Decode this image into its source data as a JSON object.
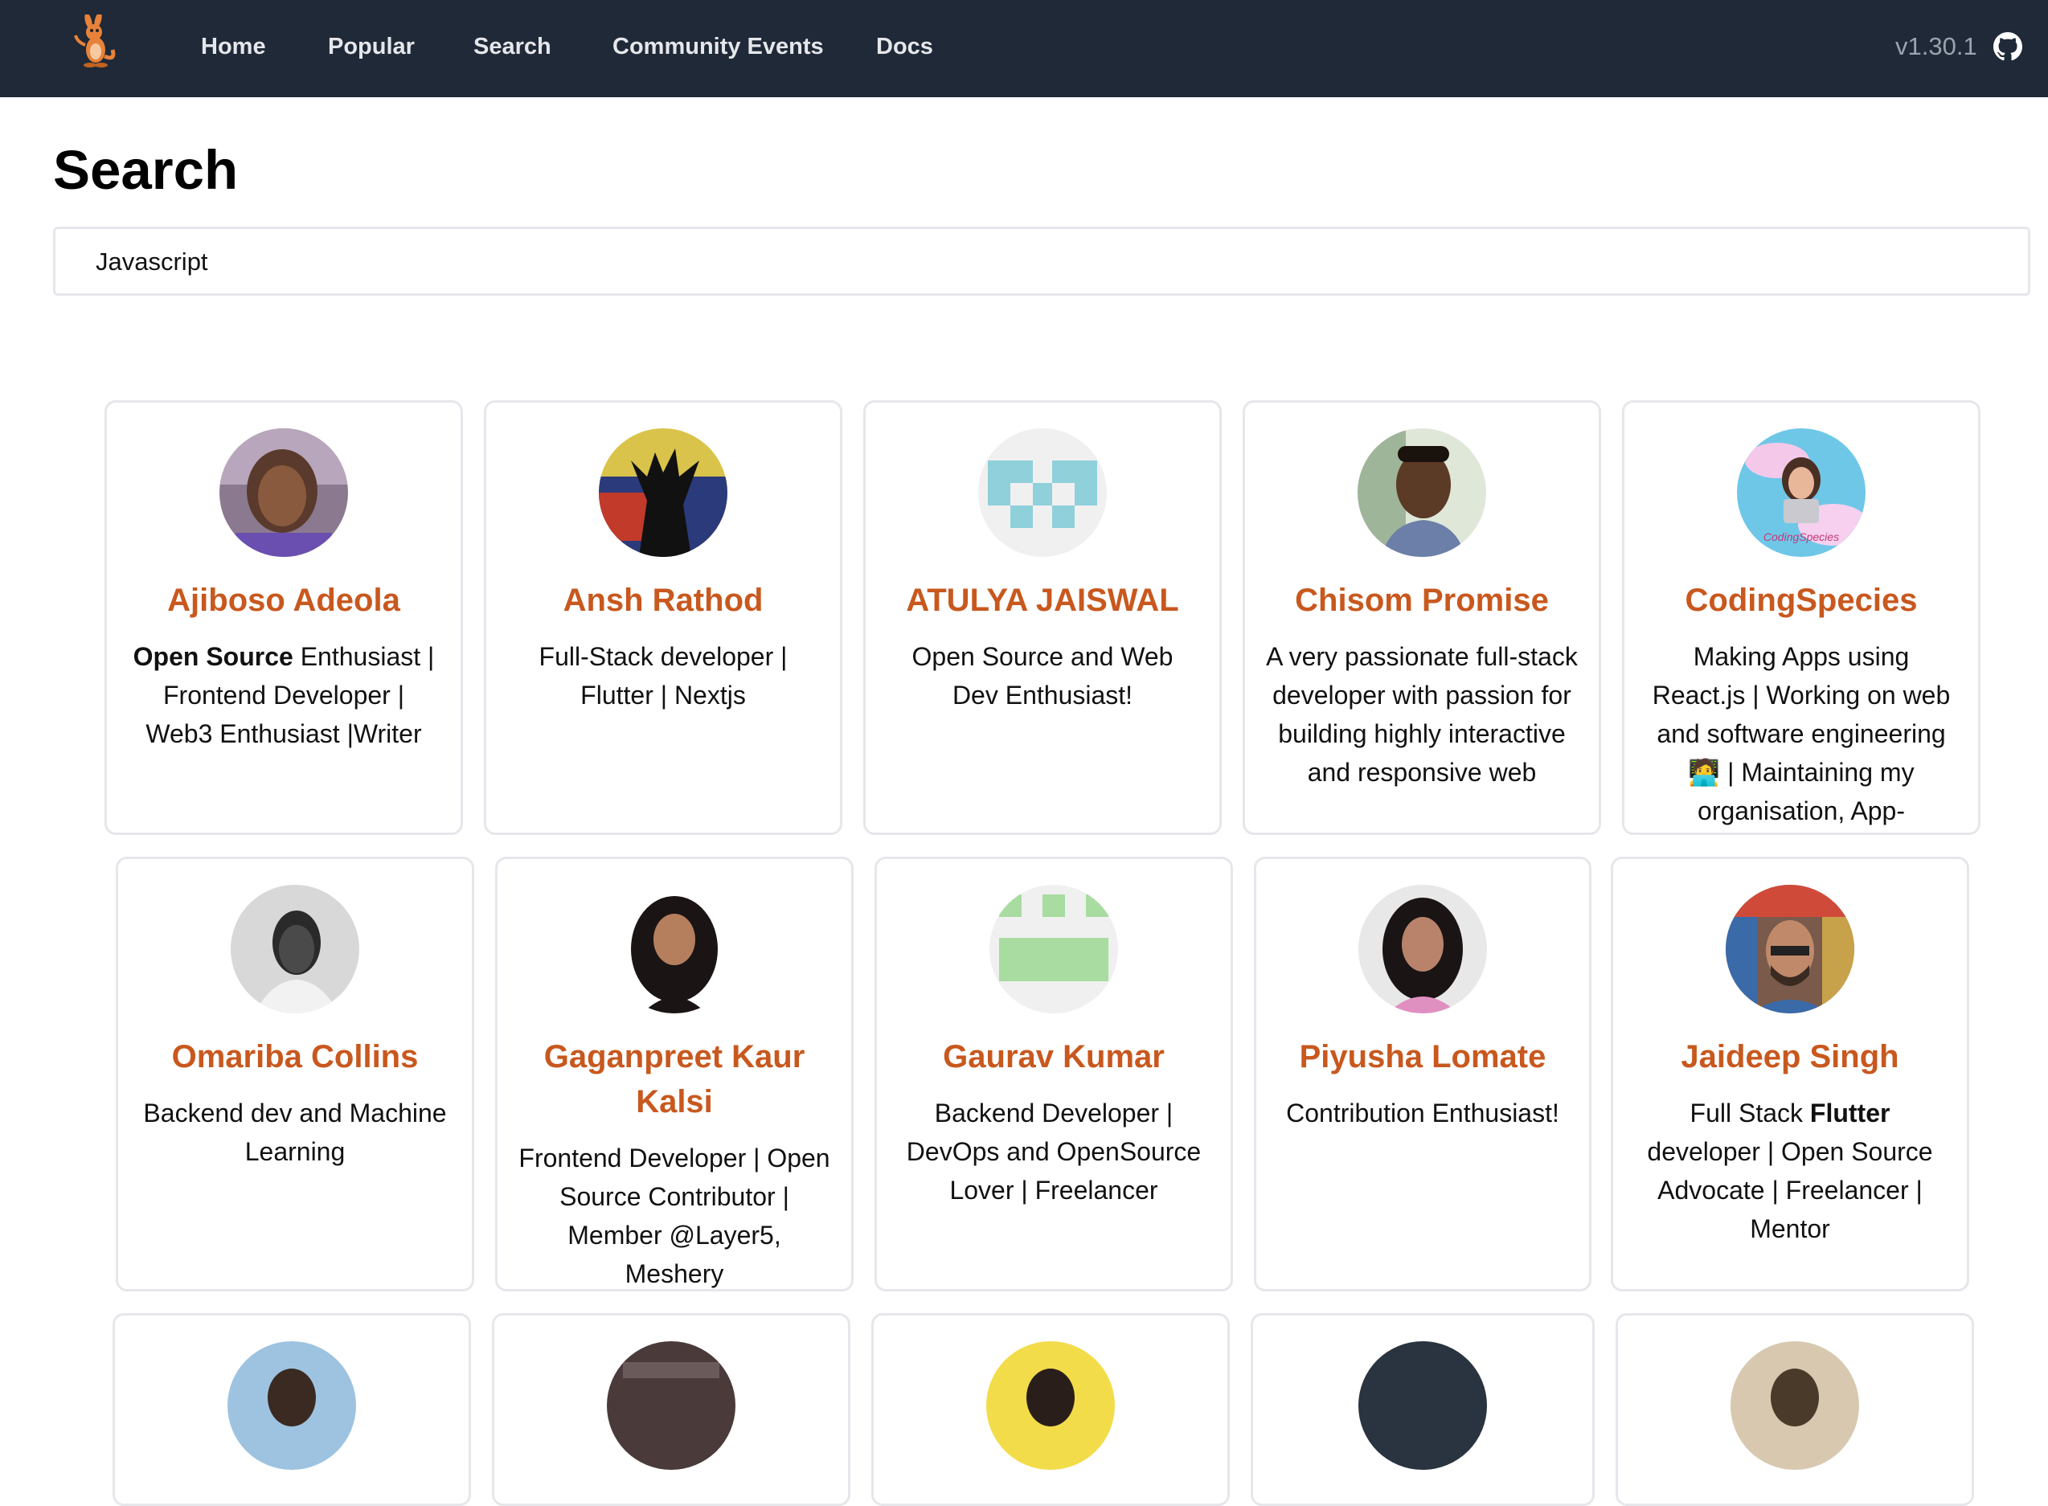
{
  "nav": {
    "logo_icon": "kangaroo-mascot-icon",
    "links": [
      "Home",
      "Popular",
      "Search",
      "Community Events",
      "Docs"
    ],
    "version": "v1.30.1",
    "github_icon": "github-icon"
  },
  "page": {
    "title": "Search",
    "search_value": "Javascript"
  },
  "colors": {
    "nav_bg": "#1f2937",
    "name_accent": "#c8581e",
    "border": "#e5e7eb"
  },
  "profiles": [
    {
      "name": "Ajiboso Adeola",
      "bio_bold": "Open Source",
      "bio": " Enthusiast | Frontend Developer | Web3 Enthusiast |Writer"
    },
    {
      "name": "Ansh Rathod",
      "bio": "Full-Stack developer | Flutter | Nextjs"
    },
    {
      "name": "ATULYA JAISWAL",
      "bio": "Open Source and Web Dev Enthusiast!"
    },
    {
      "name": "Chisom Promise",
      "bio": "A very passionate full-stack developer with passion for building highly interactive and responsive web"
    },
    {
      "name": "CodingSpecies",
      "bio": "Making Apps using React.js | Working on web and software engineering 🧑‍💻 | Maintaining my organisation, App-"
    },
    {
      "name": "Omariba Collins",
      "bio": "Backend dev and Machine Learning"
    },
    {
      "name": "Gaganpreet Kaur Kalsi",
      "bio": "Frontend Developer | Open Source Contributor | Member @Layer5, Meshery"
    },
    {
      "name": "Gaurav Kumar",
      "bio": "Backend Developer | DevOps and OpenSource Lover | Freelancer"
    },
    {
      "name": "Piyusha Lomate",
      "bio": "Contribution Enthusiast!"
    },
    {
      "name": "Jaideep Singh",
      "bio_pre": "Full Stack ",
      "bio_bold": "Flutter",
      "bio": " developer | Open Source Advocate | Freelancer | Mentor"
    }
  ]
}
